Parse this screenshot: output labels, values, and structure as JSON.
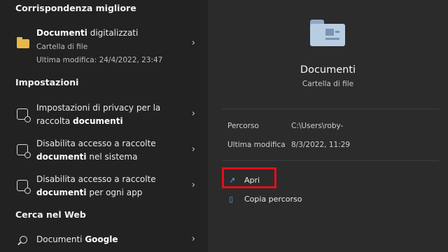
{
  "left": {
    "best_match": {
      "header": "Corrispondenza migliore",
      "name_bold": "Documenti",
      "name_rest": " digitalizzati",
      "type": "Cartella di file",
      "modified": "Ultima modifica: 24/4/2022, 23:47"
    },
    "settings": {
      "header": "Impostazioni",
      "items": [
        {
          "line1": "Impostazioni di privacy per la",
          "line2_pre": "raccolta ",
          "line2_bold": "documenti",
          "line2_post": ""
        },
        {
          "line1": "Disabilita accesso a raccolte",
          "line2_pre": "",
          "line2_bold": "documenti",
          "line2_post": " nel sistema"
        },
        {
          "line1": "Disabilita accesso a raccolte",
          "line2_pre": "",
          "line2_bold": "documenti",
          "line2_post": " per ogni app"
        }
      ]
    },
    "web": {
      "header": "Cerca nel Web",
      "query_pre": "Documenti ",
      "query_bold": "Google"
    },
    "chevron": "›"
  },
  "right": {
    "title": "Documenti",
    "subtitle": "Cartella di file",
    "details": [
      {
        "label": "Percorso",
        "value": "C:\\Users\\roby-"
      },
      {
        "label": "Ultima modifica",
        "value": "8/3/2022, 11:29"
      }
    ],
    "actions": [
      {
        "label": "Apri",
        "icon": "open-icon"
      },
      {
        "label": "Copia percorso",
        "icon": "copy-icon"
      }
    ]
  },
  "colors": {
    "highlight": "#e0101a",
    "accent": "#5aa7e6",
    "folder": "#e8b84a"
  }
}
